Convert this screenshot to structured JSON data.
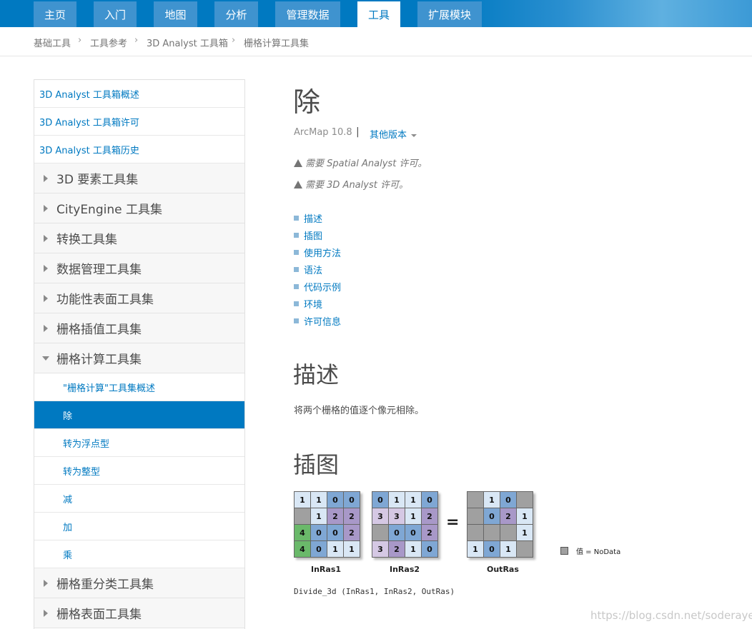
{
  "nav": {
    "tabs": [
      {
        "label": "主页"
      },
      {
        "label": "入门"
      },
      {
        "label": "地图"
      },
      {
        "label": "分析"
      },
      {
        "label": "管理数据"
      },
      {
        "label": "工具",
        "active": true
      },
      {
        "label": "扩展模块"
      }
    ]
  },
  "breadcrumb": [
    "基础工具",
    "工具参考",
    "3D Analyst 工具箱",
    "栅格计算工具集"
  ],
  "sidebar": {
    "links": [
      "3D Analyst 工具箱概述",
      "3D Analyst 工具箱许可",
      "3D Analyst 工具箱历史"
    ],
    "groups": [
      "3D 要素工具集",
      "CityEngine 工具集",
      "转换工具集",
      "数据管理工具集",
      "功能性表面工具集",
      "栅格插值工具集",
      "栅格计算工具集"
    ],
    "subitems": [
      "\"栅格计算\"工具集概述",
      "除",
      "转为浮点型",
      "转为整型",
      "减",
      "加",
      "乘"
    ],
    "groups_after": [
      "栅格重分类工具集",
      "栅格表面工具集"
    ]
  },
  "main": {
    "title": "除",
    "version": "ArcMap 10.8",
    "separator": "|",
    "other_versions": "其他版本",
    "license1": "需要 Spatial Analyst 许可。",
    "license2": "需要 3D Analyst 许可。",
    "toc": [
      "描述",
      "插图",
      "使用方法",
      "语法",
      "代码示例",
      "环境",
      "许可信息"
    ],
    "section_desc_title": "描述",
    "description": "将两个栅格的值逐个像元相除。",
    "section_illus_title": "插图",
    "code_line": "Divide_3d (InRas1, InRas2, OutRas)"
  },
  "illustration": {
    "equals": "=",
    "legend": "值 = NoData",
    "rasters": [
      {
        "label": "InRas1",
        "cells": [
          [
            "1",
            "1",
            "0",
            "0"
          ],
          [
            "",
            "1",
            "2",
            "2"
          ],
          [
            "4",
            "0",
            "0",
            "2"
          ],
          [
            "4",
            "0",
            "1",
            "1"
          ]
        ]
      },
      {
        "label": "InRas2",
        "cells": [
          [
            "0",
            "1",
            "1",
            "0"
          ],
          [
            "3",
            "3",
            "1",
            "2"
          ],
          [
            "",
            "0",
            "0",
            "2"
          ],
          [
            "3",
            "2",
            "1",
            "0"
          ]
        ]
      },
      {
        "label": "OutRas",
        "cells": [
          [
            "",
            "1",
            "0",
            ""
          ],
          [
            "",
            "0",
            "2",
            "1"
          ],
          [
            "",
            "",
            "",
            "1"
          ],
          [
            "1",
            "0",
            "1",
            ""
          ]
        ]
      }
    ],
    "colors": {
      "0": "#7fa7d4",
      "1": "#d9e7f5",
      "2": "#a898c8",
      "3": "#d5c8e4",
      "4": "#6ab96a",
      "nodata": "#a0a0a0"
    }
  },
  "watermark": "https://blog.csdn.net/soderayer"
}
